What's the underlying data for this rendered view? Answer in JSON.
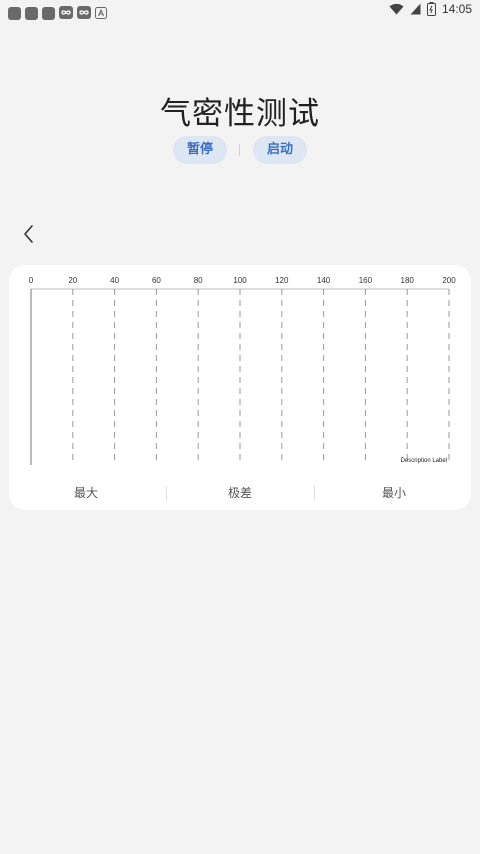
{
  "status_bar": {
    "time": "14:05",
    "left_icons": [
      "app-icon",
      "app-icon",
      "app-icon",
      "infinity-icon",
      "infinity-icon",
      "font-icon"
    ],
    "right_icons": [
      "wifi-icon",
      "signal-icon",
      "battery-icon"
    ]
  },
  "header": {
    "title": "气密性测试"
  },
  "controls": {
    "pause_label": "暂停",
    "start_label": "启动"
  },
  "chart_data": {
    "type": "line",
    "x_ticks": [
      "0",
      "20",
      "40",
      "60",
      "80",
      "100",
      "120",
      "140",
      "160",
      "180",
      "200"
    ],
    "xlim": [
      0,
      200
    ],
    "grid": true,
    "description_label": "Description Label",
    "series": []
  },
  "stats": {
    "max_label": "最大",
    "range_label": "极差",
    "min_label": "最小"
  },
  "colors": {
    "background": "#f3f3f3",
    "card": "#ffffff",
    "button_bg": "#dde6f3",
    "button_text": "#3a6fc4"
  }
}
